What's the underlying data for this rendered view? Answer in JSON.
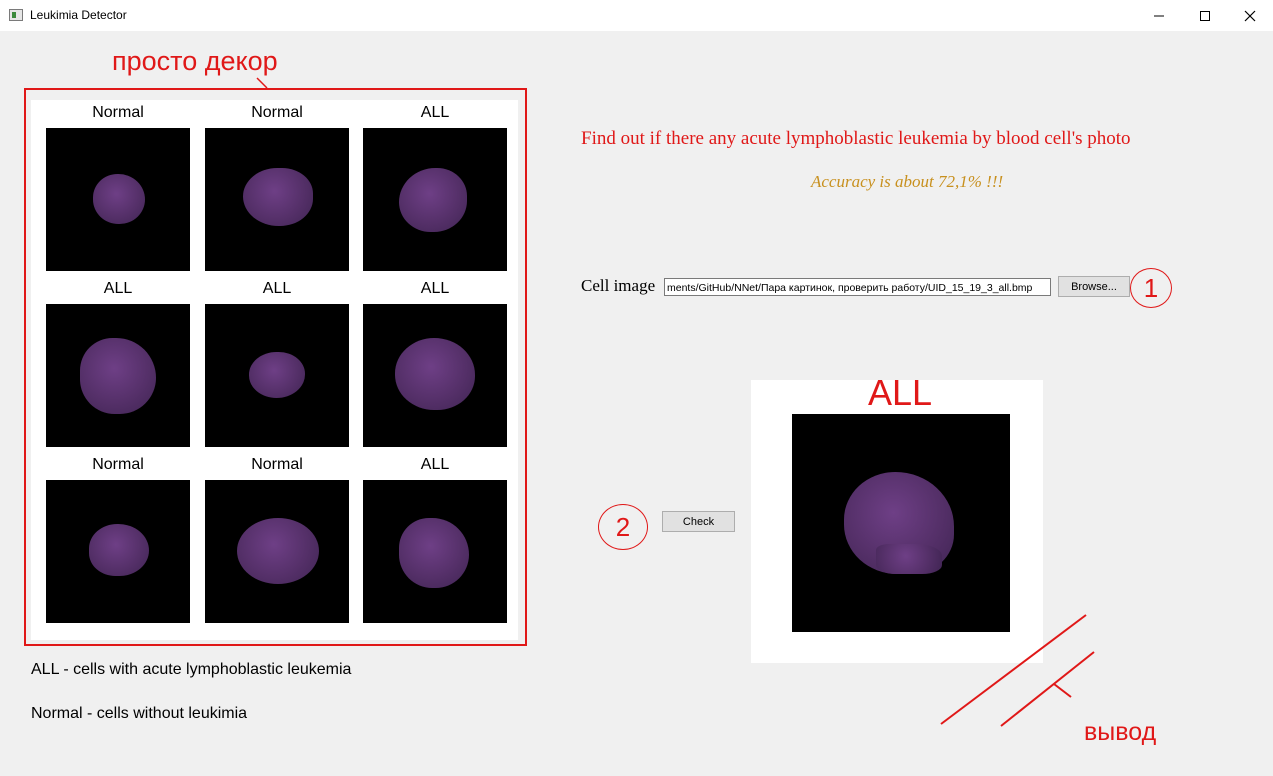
{
  "window": {
    "title": "Leukimia Detector",
    "controls": [
      "minimize-icon",
      "maximize-icon",
      "close-icon"
    ]
  },
  "annotations": {
    "decor_note": "просто декор",
    "output_note": "вывод",
    "step1": "1",
    "step2": "2",
    "color": "#e01818"
  },
  "gallery": {
    "cells": [
      {
        "label": "Normal"
      },
      {
        "label": "Normal"
      },
      {
        "label": "ALL"
      },
      {
        "label": "ALL"
      },
      {
        "label": "ALL"
      },
      {
        "label": "ALL"
      },
      {
        "label": "Normal"
      },
      {
        "label": "Normal"
      },
      {
        "label": "ALL"
      }
    ]
  },
  "main": {
    "headline": "Find out if there any acute lymphoblastic leukemia by blood cell's photo",
    "accuracy": "Accuracy is about 72,1% !!!",
    "cell_image_label": "Cell image",
    "path_value": "ments/GitHub/NNet/Пара картинок, проверить работу/UID_15_19_3_all.bmp",
    "browse_label": "Browse...",
    "check_label": "Check",
    "result_label": "ALL"
  },
  "legend": {
    "all": "ALL - cells with acute lymphoblastic leukemia",
    "normal": "Normal - cells without leukimia"
  },
  "colors": {
    "headline": "#e01818",
    "accuracy": "#c8901e",
    "background": "#f0f0f0"
  }
}
